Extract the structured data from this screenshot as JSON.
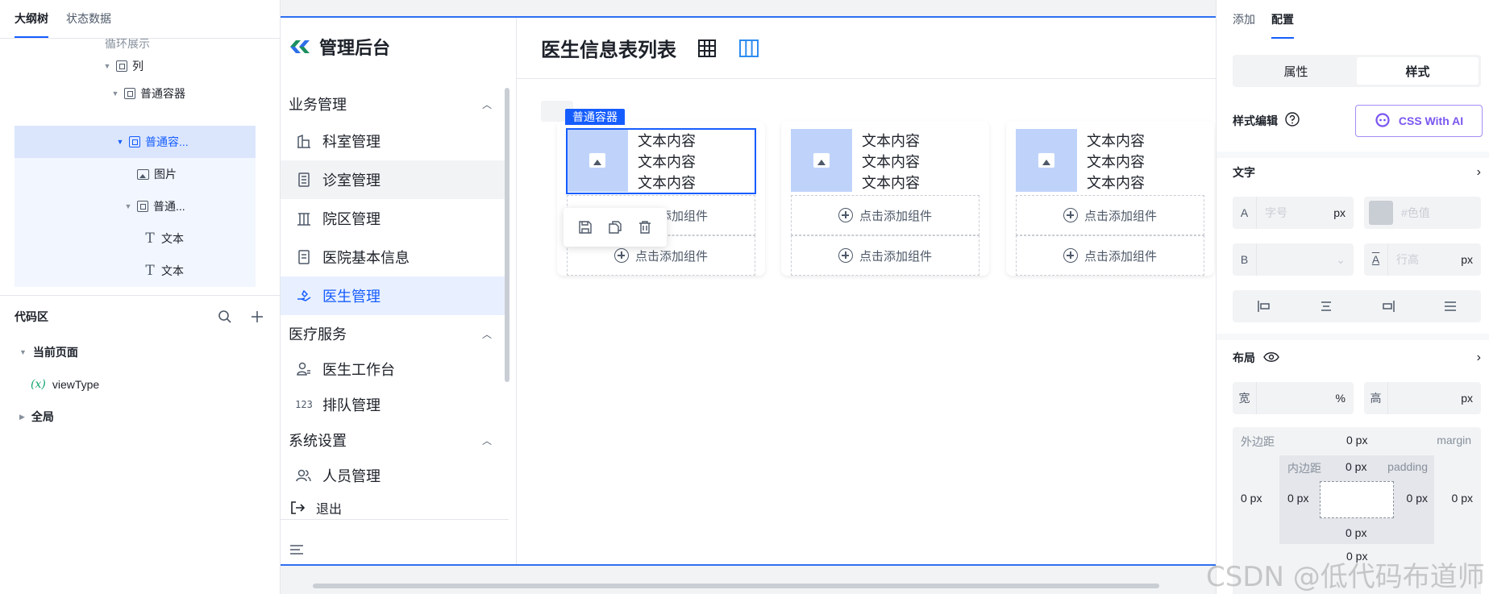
{
  "left": {
    "tabs": [
      "大纲树",
      "状态数据"
    ],
    "tree": {
      "partial_top": "循环展示",
      "items": [
        {
          "label": "列"
        },
        {
          "label": "普通容器"
        },
        {
          "label": "普通容..."
        },
        {
          "label": "图片"
        },
        {
          "label": "普通..."
        },
        {
          "label": "文本"
        },
        {
          "label": "文本"
        }
      ]
    },
    "code": {
      "title": "代码区",
      "current_page": "当前页面",
      "var_prefix": "(x)",
      "var_name": "viewType",
      "global": "全局"
    }
  },
  "app": {
    "brand": "管理后台",
    "nav": {
      "group1": "业务管理",
      "item_dept": "科室管理",
      "item_clinic": "诊室管理",
      "item_campus": "院区管理",
      "item_hospital": "医院基本信息",
      "item_doctor": "医生管理",
      "group2": "医疗服务",
      "item_workbench": "医生工作台",
      "item_queue": "排队管理",
      "group3": "系统设置",
      "item_staff": "人员管理",
      "logout": "退出"
    },
    "page_title": "医生信息表列表",
    "selected_tag": "普通容器",
    "card_text": "文本内容",
    "add_component": "点击添加组件"
  },
  "right": {
    "tabs": [
      "添加",
      "配置"
    ],
    "segments": [
      "属性",
      "样式"
    ],
    "style_edit": "样式编辑",
    "css_ai": "CSS With AI",
    "text_section": "文字",
    "font_size_prefix": "A",
    "font_size_placeholder": "字号",
    "unit_px": "px",
    "color_placeholder": "#色值",
    "bold_prefix": "B",
    "line_height_placeholder": "行高",
    "layout_section": "布局",
    "width_label": "宽",
    "width_unit": "%",
    "height_label": "高",
    "box": {
      "margin_cn": "外边距",
      "margin_en": "margin",
      "padding_cn": "内边距",
      "padding_en": "padding",
      "zero": "0 px"
    }
  },
  "watermark": "CSDN @低代码布道师",
  "colors": {
    "accent": "#165dff",
    "selected_bg": "#dbe6fd",
    "thumb": "#bfd3fa",
    "ai": "#7a56f0"
  }
}
